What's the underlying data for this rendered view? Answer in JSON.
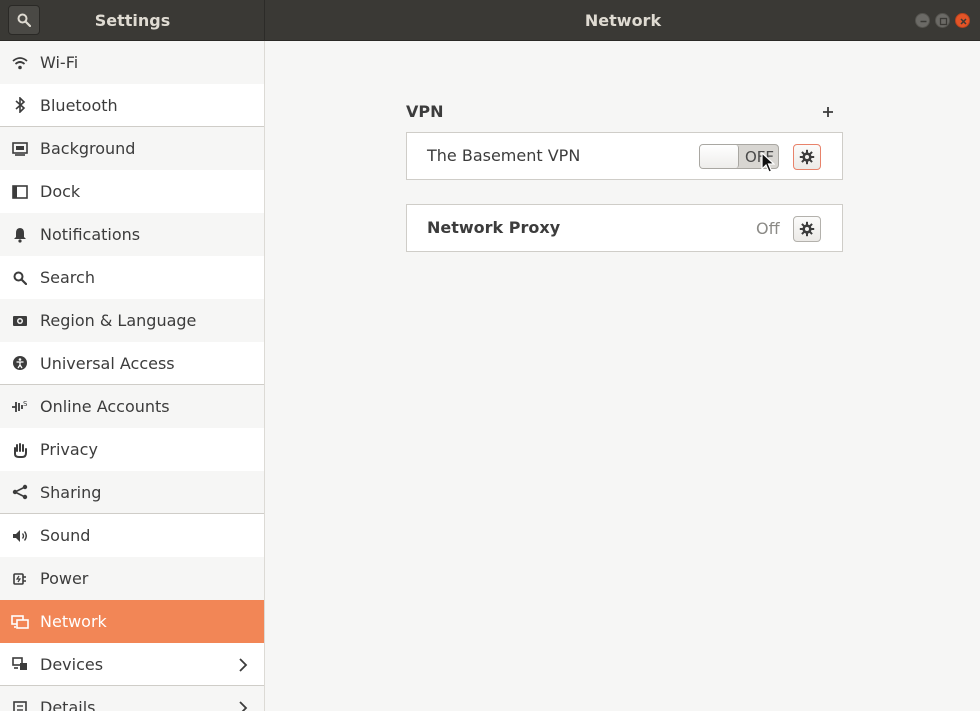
{
  "header": {
    "sidebar_title": "Settings",
    "panel_title": "Network",
    "search_icon": "search-icon",
    "window_controls": [
      "minimize-icon",
      "maximize-icon",
      "close-icon"
    ]
  },
  "sidebar": {
    "items": [
      {
        "label": "Wi-Fi",
        "icon": "wifi-icon"
      },
      {
        "label": "Bluetooth",
        "icon": "bluetooth-icon"
      },
      {
        "label": "Background",
        "icon": "background-icon"
      },
      {
        "label": "Dock",
        "icon": "dock-icon"
      },
      {
        "label": "Notifications",
        "icon": "bell-icon"
      },
      {
        "label": "Search",
        "icon": "search-icon"
      },
      {
        "label": "Region & Language",
        "icon": "region-icon"
      },
      {
        "label": "Universal Access",
        "icon": "accessibility-icon"
      },
      {
        "label": "Online Accounts",
        "icon": "online-accounts-icon"
      },
      {
        "label": "Privacy",
        "icon": "hand-icon"
      },
      {
        "label": "Sharing",
        "icon": "share-icon"
      },
      {
        "label": "Sound",
        "icon": "speaker-icon"
      },
      {
        "label": "Power",
        "icon": "power-icon"
      },
      {
        "label": "Network",
        "icon": "network-icon",
        "active": true
      },
      {
        "label": "Devices",
        "icon": "devices-icon",
        "has_arrow": true
      },
      {
        "label": "Details",
        "icon": "details-icon",
        "has_arrow": true
      }
    ]
  },
  "main": {
    "vpn_section_label": "VPN",
    "vpn_row": {
      "name": "The Basement VPN",
      "switch_text": "OFF",
      "switch_on": false
    },
    "proxy_row": {
      "name": "Network Proxy",
      "status": "Off"
    }
  },
  "colors": {
    "accent": "#f28656",
    "header_bg": "#3a3935",
    "close_button": "#e25427"
  }
}
